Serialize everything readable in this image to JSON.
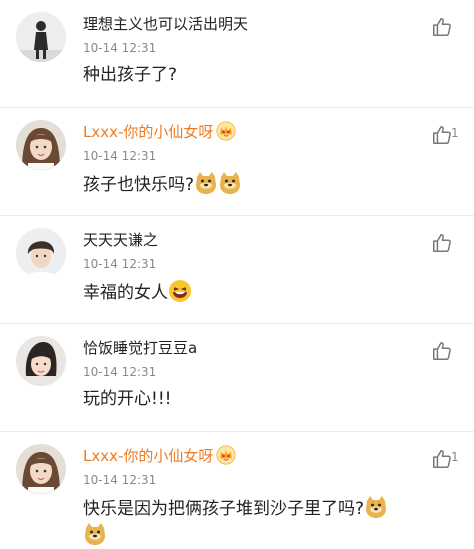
{
  "comments": [
    {
      "name": "理想主义也可以活出明天",
      "time": "10-14 12:31",
      "text": "种出孩子了?",
      "likes": ""
    },
    {
      "name": "Lxxx-你的小仙女呀",
      "time": "10-14 12:31",
      "text": "孩子也快乐吗?",
      "likes": "1"
    },
    {
      "name": "天天天谦之",
      "time": "10-14 12:31",
      "text": "幸福的女人",
      "likes": ""
    },
    {
      "name": "恰饭睡觉打豆豆a",
      "time": "10-14 12:31",
      "text": "玩的开心!!!",
      "likes": ""
    },
    {
      "name": "Lxxx-你的小仙女呀",
      "time": "10-14 12:31",
      "text": "快乐是因为把俩孩子堆到沙子里了吗?",
      "likes": "1"
    }
  ],
  "colors": {
    "vip_name": "#f07b1f",
    "time": "#8a8a8a",
    "text": "#222222"
  },
  "icons": {
    "like": "thumbs-up-icon",
    "badge": "crown-badge-icon",
    "doge": "doge-emoji-icon",
    "laugh": "laugh-emoji-icon"
  }
}
